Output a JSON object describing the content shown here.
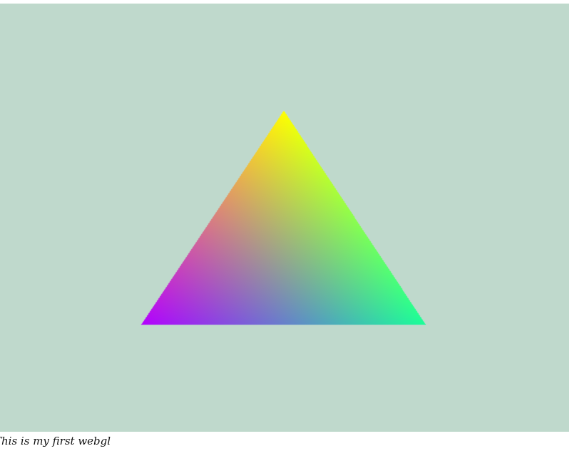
{
  "canvas": {
    "background_color": "#bfd9cc"
  },
  "triangle": {
    "vertex_colors": {
      "top": "#ffff00",
      "bottom_left": "#b300ff",
      "bottom_right": "#1aff99"
    }
  },
  "caption": {
    "text": "This is my first webgl"
  }
}
